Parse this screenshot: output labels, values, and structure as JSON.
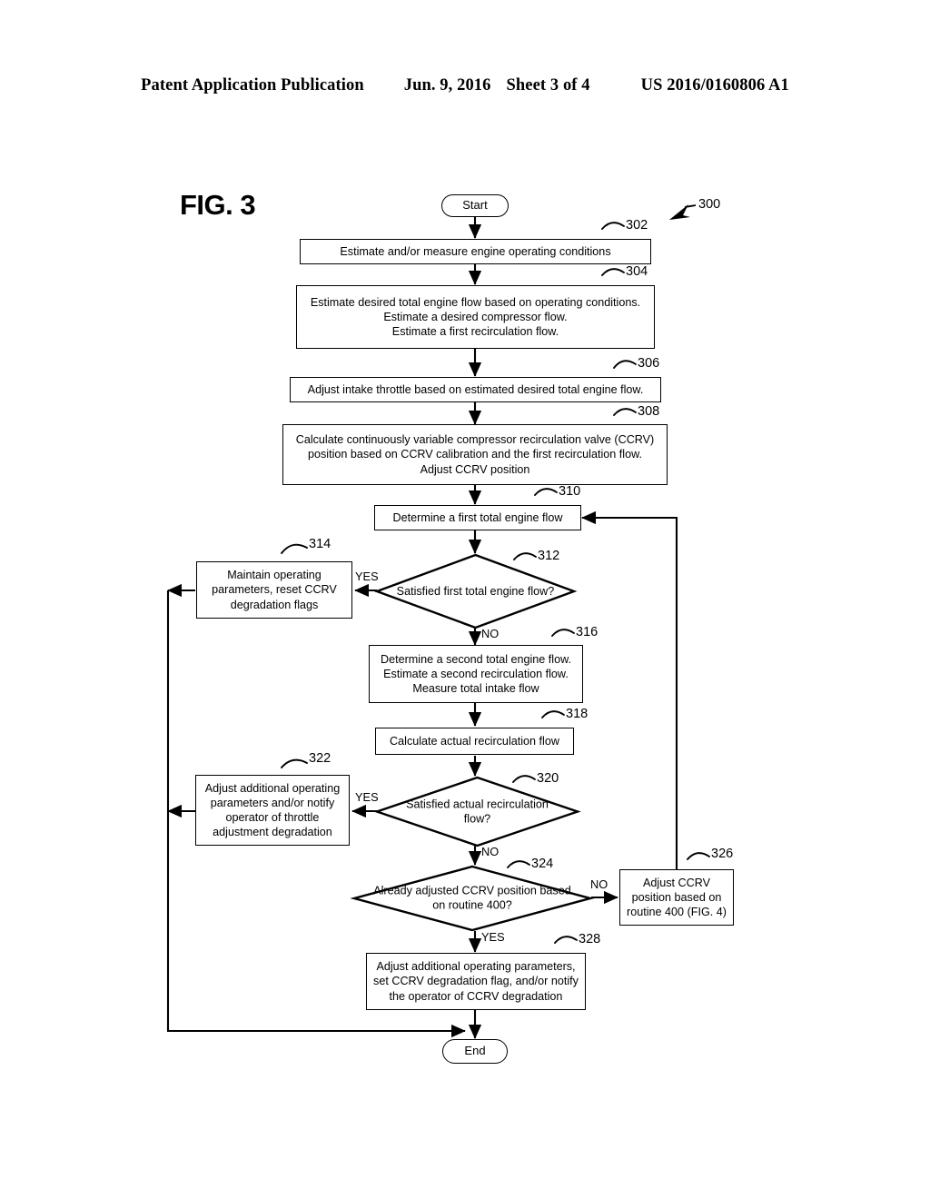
{
  "header": {
    "publication": "Patent Application Publication",
    "date": "Jun. 9, 2016",
    "sheet": "Sheet 3 of 4",
    "patent_number": "US 2016/0160806 A1"
  },
  "figure": {
    "label": "FIG. 3",
    "routine_ref": "300"
  },
  "flowchart": {
    "start": {
      "label": "Start"
    },
    "end": {
      "label": "End"
    },
    "steps": [
      {
        "ref": "302",
        "text": "Estimate and/or measure engine operating conditions"
      },
      {
        "ref": "304",
        "text": "Estimate desired total engine flow based on operating conditions.\nEstimate a desired compressor flow.\nEstimate a first recirculation flow."
      },
      {
        "ref": "306",
        "text": "Adjust intake throttle based on estimated desired total engine flow."
      },
      {
        "ref": "308",
        "text": "Calculate continuously variable compressor recirculation valve  (CCRV) position based on CCRV calibration and the first recirculation flow.\nAdjust CCRV position"
      },
      {
        "ref": "310",
        "text": "Determine a first total engine flow"
      },
      {
        "ref": "312",
        "text": "Satisfied first total engine flow?",
        "type": "decision"
      },
      {
        "ref": "314",
        "text": "Maintain operating parameters, reset CCRV degradation flags"
      },
      {
        "ref": "316",
        "text": "Determine a second total engine flow.\nEstimate a second recirculation flow.\nMeasure total intake flow"
      },
      {
        "ref": "318",
        "text": "Calculate actual recirculation flow"
      },
      {
        "ref": "320",
        "text": "Satisfied actual recirculation flow?",
        "type": "decision"
      },
      {
        "ref": "322",
        "text": "Adjust additional operating parameters and/or notify operator of throttle adjustment degradation"
      },
      {
        "ref": "324",
        "text": "Already adjusted CCRV position based on routine 400?",
        "type": "decision"
      },
      {
        "ref": "326",
        "text": "Adjust CCRV position based on routine 400 (FIG. 4)"
      },
      {
        "ref": "328",
        "text": "Adjust additional operating parameters, set CCRV degradation flag, and/or notify the operator of CCRV degradation"
      }
    ],
    "branch_labels": {
      "d312_yes": "YES",
      "d312_no": "NO",
      "d320_yes": "YES",
      "d320_no": "NO",
      "d324_no": "NO",
      "d324_yes": "YES"
    }
  },
  "colors": {
    "ink": "#000000",
    "paper": "#ffffff"
  }
}
